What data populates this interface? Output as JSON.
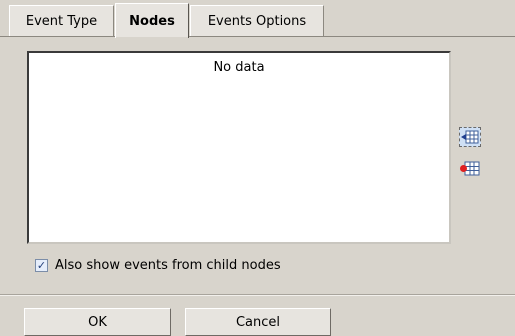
{
  "tabs": [
    {
      "label": "Event Type"
    },
    {
      "label": "Nodes"
    },
    {
      "label": "Events Options"
    }
  ],
  "nodes_list": {
    "empty_text": "No data"
  },
  "side_buttons": {
    "add_icon": "add-node-icon",
    "remove_icon": "remove-node-icon"
  },
  "options": {
    "child_nodes_label": "Also show events from child nodes",
    "child_nodes_checked": true
  },
  "buttons": {
    "ok_label": "OK",
    "cancel_label": "Cancel"
  },
  "colors": {
    "tab_active_bg": "#e7e4df",
    "dialog_bg": "#d8d4cc",
    "check_mark": "#25407a"
  }
}
